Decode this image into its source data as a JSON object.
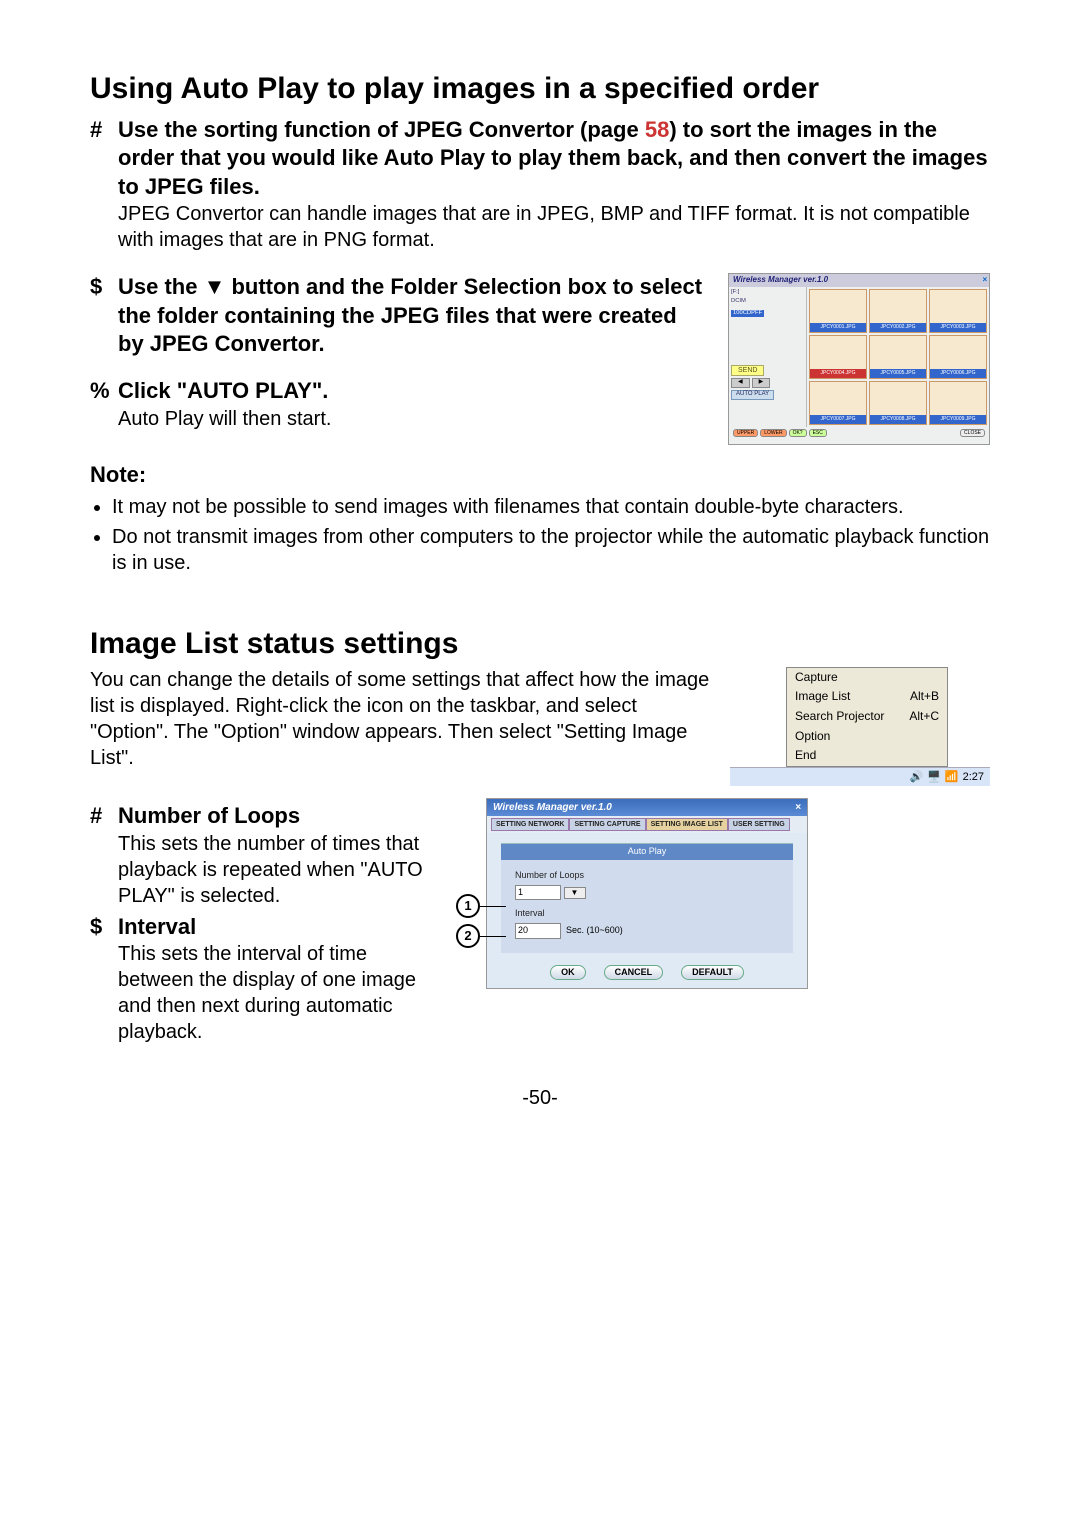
{
  "heading1": "Using Auto Play to play images in a specified order",
  "step1": {
    "marker": "#",
    "title_a": "Use the sorting function of JPEG Convertor (page ",
    "page_ref": "58",
    "title_b": ") to sort the images in the order that you would like Auto Play to play them back, and then convert the images to JPEG files.",
    "desc": "JPEG Convertor can handle images that are in JPEG, BMP and TIFF format. It is not compatible with images that are in PNG format."
  },
  "step2": {
    "marker": "$",
    "title": "Use the ▼ button and the Folder Selection box to select the folder containing the JPEG files that were created by JPEG Convertor."
  },
  "step3": {
    "marker": "%",
    "title": "Click \"AUTO PLAY\".",
    "desc": "Auto Play will then start."
  },
  "note_label": "Note:",
  "notes": [
    "It may not be possible to send images with filenames that contain double-byte characters.",
    "Do not transmit images from other computers to the projector while the automatic playback function is in use."
  ],
  "heading2": "Image List status settings",
  "intro2": "You can change the details of some settings that affect how the image list is displayed. Right-click the icon on the taskbar, and select \"Option\". The \"Option\" window appears. Then select \"Setting Image List\".",
  "item1": {
    "marker": "#",
    "title": "Number of Loops",
    "desc": "This sets the number of times that playback is repeated when \"AUTO PLAY\" is selected."
  },
  "item2": {
    "marker": "$",
    "title": "Interval",
    "desc": "This sets the interval of time between the display of one image and then next during automatic playback."
  },
  "scr1": {
    "title": "Wireless Manager ver.1.0",
    "tree1": "[F:]",
    "tree2": "DCIM",
    "folder_hl": "100CDPFF",
    "thumbs": [
      "JPCY0001.JPG",
      "JPCY0002.JPG",
      "JPCY0003.JPG",
      "JPCY0004.JPG",
      "JPCY0005.JPG",
      "JPCY0006.JPG",
      "JPCY0007.JPG",
      "JPCY0008.JPG",
      "JPCY0009.JPG"
    ],
    "send": "SEND",
    "autoplay": "AUTO PLAY",
    "btns": [
      "UPPER",
      "LOWER",
      "OK?",
      "ESC",
      "CLOSE"
    ]
  },
  "scr2": {
    "items": [
      {
        "label": "Capture",
        "accel": ""
      },
      {
        "label": "Image List",
        "accel": "Alt+B"
      },
      {
        "label": "Search Projector",
        "accel": "Alt+C"
      },
      {
        "label": "Option",
        "accel": ""
      },
      {
        "label": "End",
        "accel": ""
      }
    ],
    "time": "2:27"
  },
  "scr3": {
    "title": "Wireless Manager ver.1.0",
    "close": "×",
    "tabs": [
      "SETTING NETWORK",
      "SETTING CAPTURE",
      "SETTING IMAGE LIST",
      "USER SETTING"
    ],
    "frame_title": "Auto Play",
    "loops_label": "Number of Loops",
    "loops_value": "1",
    "interval_label": "Interval",
    "interval_value": "20",
    "interval_unit": "Sec. (10~600)",
    "ok": "OK",
    "cancel": "CANCEL",
    "default": "DEFAULT"
  },
  "callouts": [
    "1",
    "2"
  ],
  "page_number": "-50-"
}
